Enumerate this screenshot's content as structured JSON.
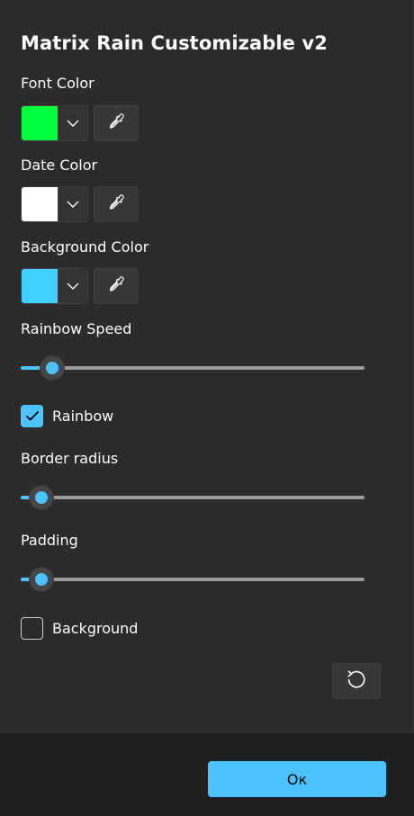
{
  "dialog": {
    "title": "Matrix Rain Customizable v2"
  },
  "font_color": {
    "label": "Font Color",
    "swatch": "#00ff3c"
  },
  "date_color": {
    "label": "Date Color",
    "swatch": "#ffffff"
  },
  "background_color": {
    "label": "Background Color",
    "swatch": "#40d0ff"
  },
  "rainbow_speed": {
    "label": "Rainbow Speed",
    "value_fraction": 0.065
  },
  "rainbow": {
    "label": "Rainbow",
    "checked": true
  },
  "border_radius": {
    "label": "Border radius",
    "value_fraction": 0.032
  },
  "padding": {
    "label": "Padding",
    "value_fraction": 0.032
  },
  "background": {
    "label": "Background",
    "checked": false
  },
  "footer": {
    "ok_label": "Ок"
  },
  "colors": {
    "accent": "#4cc2ff",
    "panel": "#2b2b2b",
    "footer": "#202020"
  },
  "icons": {
    "dropdown": "chevron-down-icon",
    "eyedropper": "eyedropper-icon",
    "reset": "reset-icon",
    "check": "checkmark-icon"
  }
}
